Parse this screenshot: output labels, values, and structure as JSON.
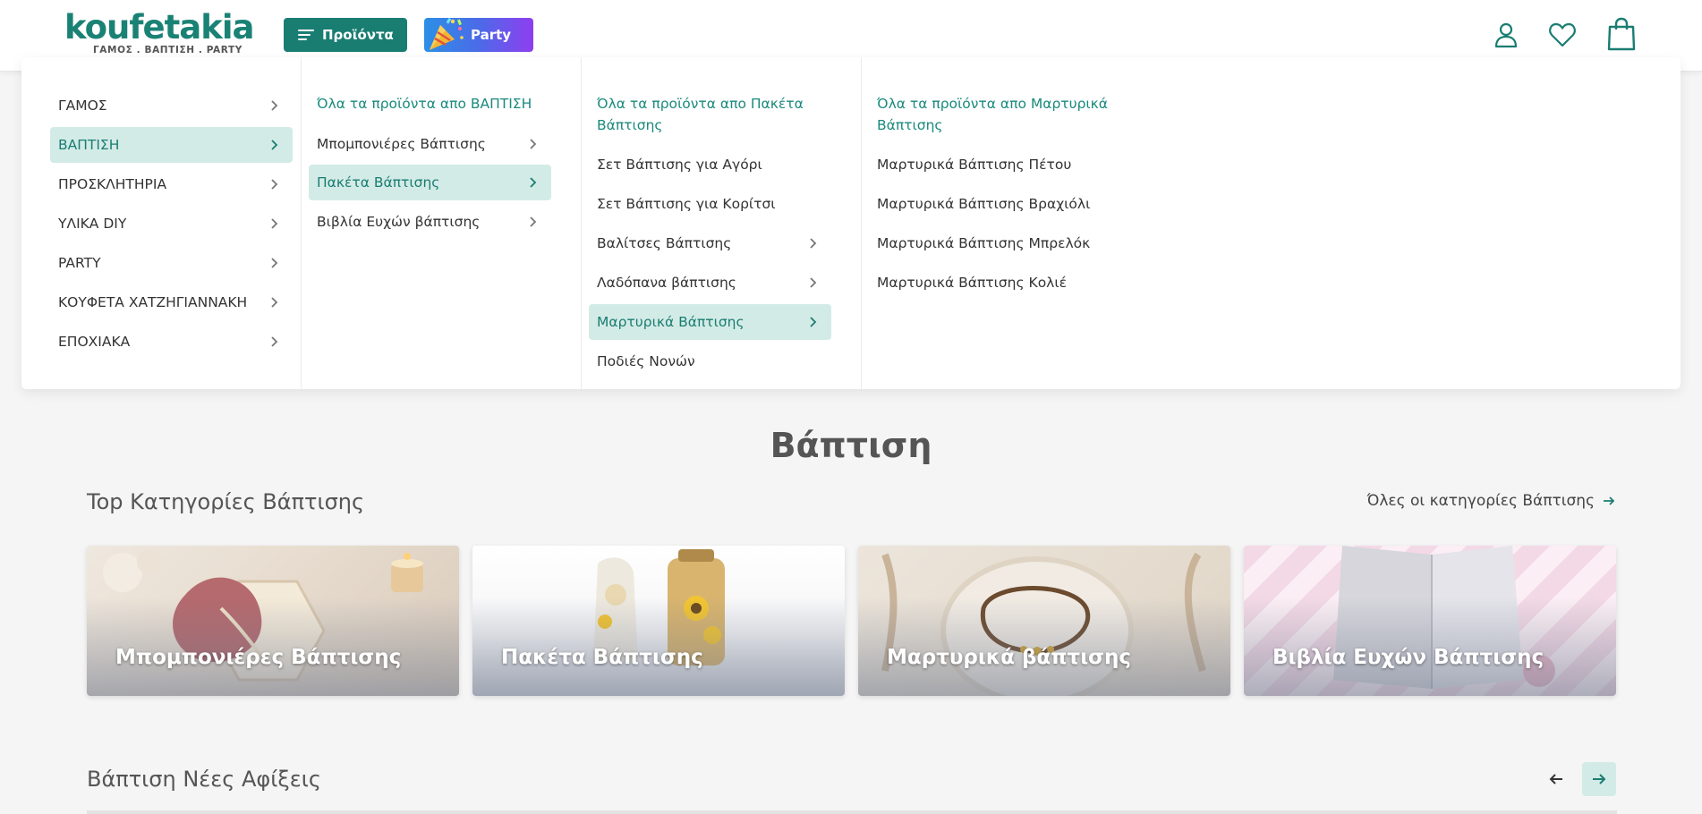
{
  "header": {
    "logo_word": "koufetakia",
    "logo_tagline": "ΓΑΜΟΣ . ΒΑΠΤΙΣΗ . PARTY",
    "products_button": "Προϊόντα",
    "party_button": "Party"
  },
  "menu": {
    "col1": [
      {
        "label": "ΓΑΜΟΣ"
      },
      {
        "label": "ΒΑΠΤΙΣΗ"
      },
      {
        "label": "ΠΡΟΣΚΛΗΤΗΡΙΑ"
      },
      {
        "label": "ΥΛΙΚΑ DIY"
      },
      {
        "label": "PARTY"
      },
      {
        "label": "ΚΟΥΦΕΤΑ ΧΑΤΖΗΓΙΑΝΝΑΚΗ"
      },
      {
        "label": "ΕΠΟΧΙΑΚΑ"
      }
    ],
    "col2_all": "Όλα τα προϊόντα απο ΒΑΠΤΙΣΗ",
    "col2": [
      {
        "label": "Μπομπονιέρες Βάπτισης"
      },
      {
        "label": "Πακέτα Βάπτισης"
      },
      {
        "label": "Βιβλία Ευχών βάπτισης"
      }
    ],
    "col3_all": "Όλα τα προϊόντα απο Πακέτα Βάπτισης",
    "col3": [
      {
        "label": "Σετ Βάπτισης για Αγόρι"
      },
      {
        "label": "Σετ Βάπτισης για Κορίτσι"
      },
      {
        "label": "Βαλίτσες Βάπτισης"
      },
      {
        "label": "Λαδόπανα βάπτισης"
      },
      {
        "label": "Μαρτυρικά Βάπτισης"
      },
      {
        "label": "Ποδιές Νονών"
      }
    ],
    "col4_all": "Όλα τα προϊόντα απο Μαρτυρικά Βάπτισης",
    "col4": [
      {
        "label": "Μαρτυρικά Βάπτισης Πέτου"
      },
      {
        "label": "Μαρτυρικά Βάπτισης Βραχιόλι"
      },
      {
        "label": "Μαρτυρικά Βάπτισης Μπρελόκ"
      },
      {
        "label": "Μαρτυρικά Βάπτισης Κολιέ"
      }
    ]
  },
  "main": {
    "title": "Βάπτιση",
    "top_categories_title": "Top Κατηγορίες Βάπτισης",
    "all_categories_link": "Όλες οι κατηγορίες Βάπτισης",
    "cards": [
      {
        "label": "Μπομπονιέρες Βάπτισης"
      },
      {
        "label": "Πακέτα Βάπτισης"
      },
      {
        "label": "Μαρτυρικά βάπτισης"
      },
      {
        "label": "Βιβλία Ευχών Βάπτισης"
      }
    ],
    "new_arrivals_title": "Βάπτιση Νέες Αφίξεις"
  },
  "colors": {
    "brand": "#1a7d72",
    "active_bg": "#d3ebe6",
    "link": "#1a8a7d"
  },
  "icons": [
    "menu-icon",
    "party-popper-icon",
    "user-icon",
    "heart-icon",
    "shopping-bag-icon",
    "chevron-right-icon",
    "arrow-right-icon",
    "arrow-left-icon"
  ]
}
